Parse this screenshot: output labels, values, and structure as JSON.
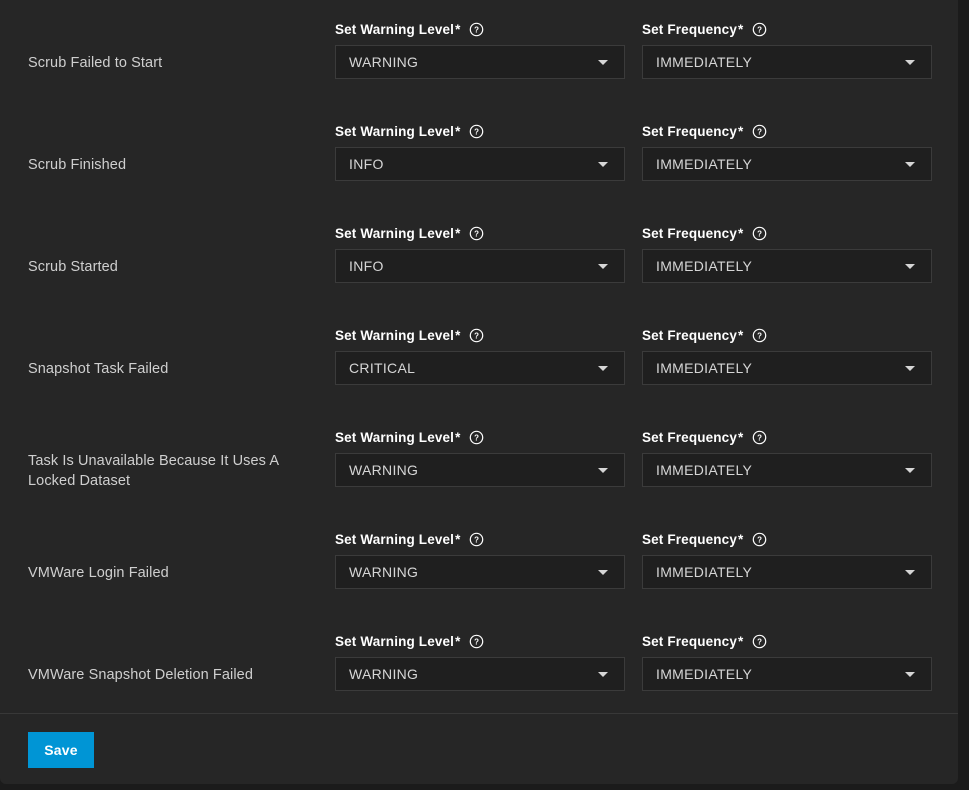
{
  "form": {
    "warning_level_label": "Set Warning Level",
    "frequency_label": "Set Frequency",
    "required_marker": "*",
    "help_icon": "help-circle-icon",
    "dropdown_icon": "chevron-down-icon",
    "accent_color": "#0095d5",
    "card_background": "#262626",
    "page_background": "#1b1b1b"
  },
  "footer": {
    "save_label": "Save"
  },
  "rows": [
    {
      "name": "Scrub Failed to Start",
      "warning_level": "WARNING",
      "frequency": "IMMEDIATELY"
    },
    {
      "name": "Scrub Finished",
      "warning_level": "INFO",
      "frequency": "IMMEDIATELY"
    },
    {
      "name": "Scrub Started",
      "warning_level": "INFO",
      "frequency": "IMMEDIATELY"
    },
    {
      "name": "Snapshot Task Failed",
      "warning_level": "CRITICAL",
      "frequency": "IMMEDIATELY"
    },
    {
      "name": "Task Is Unavailable Because It Uses A Locked Dataset",
      "warning_level": "WARNING",
      "frequency": "IMMEDIATELY"
    },
    {
      "name": "VMWare Login Failed",
      "warning_level": "WARNING",
      "frequency": "IMMEDIATELY"
    },
    {
      "name": "VMWare Snapshot Deletion Failed",
      "warning_level": "WARNING",
      "frequency": "IMMEDIATELY"
    }
  ]
}
